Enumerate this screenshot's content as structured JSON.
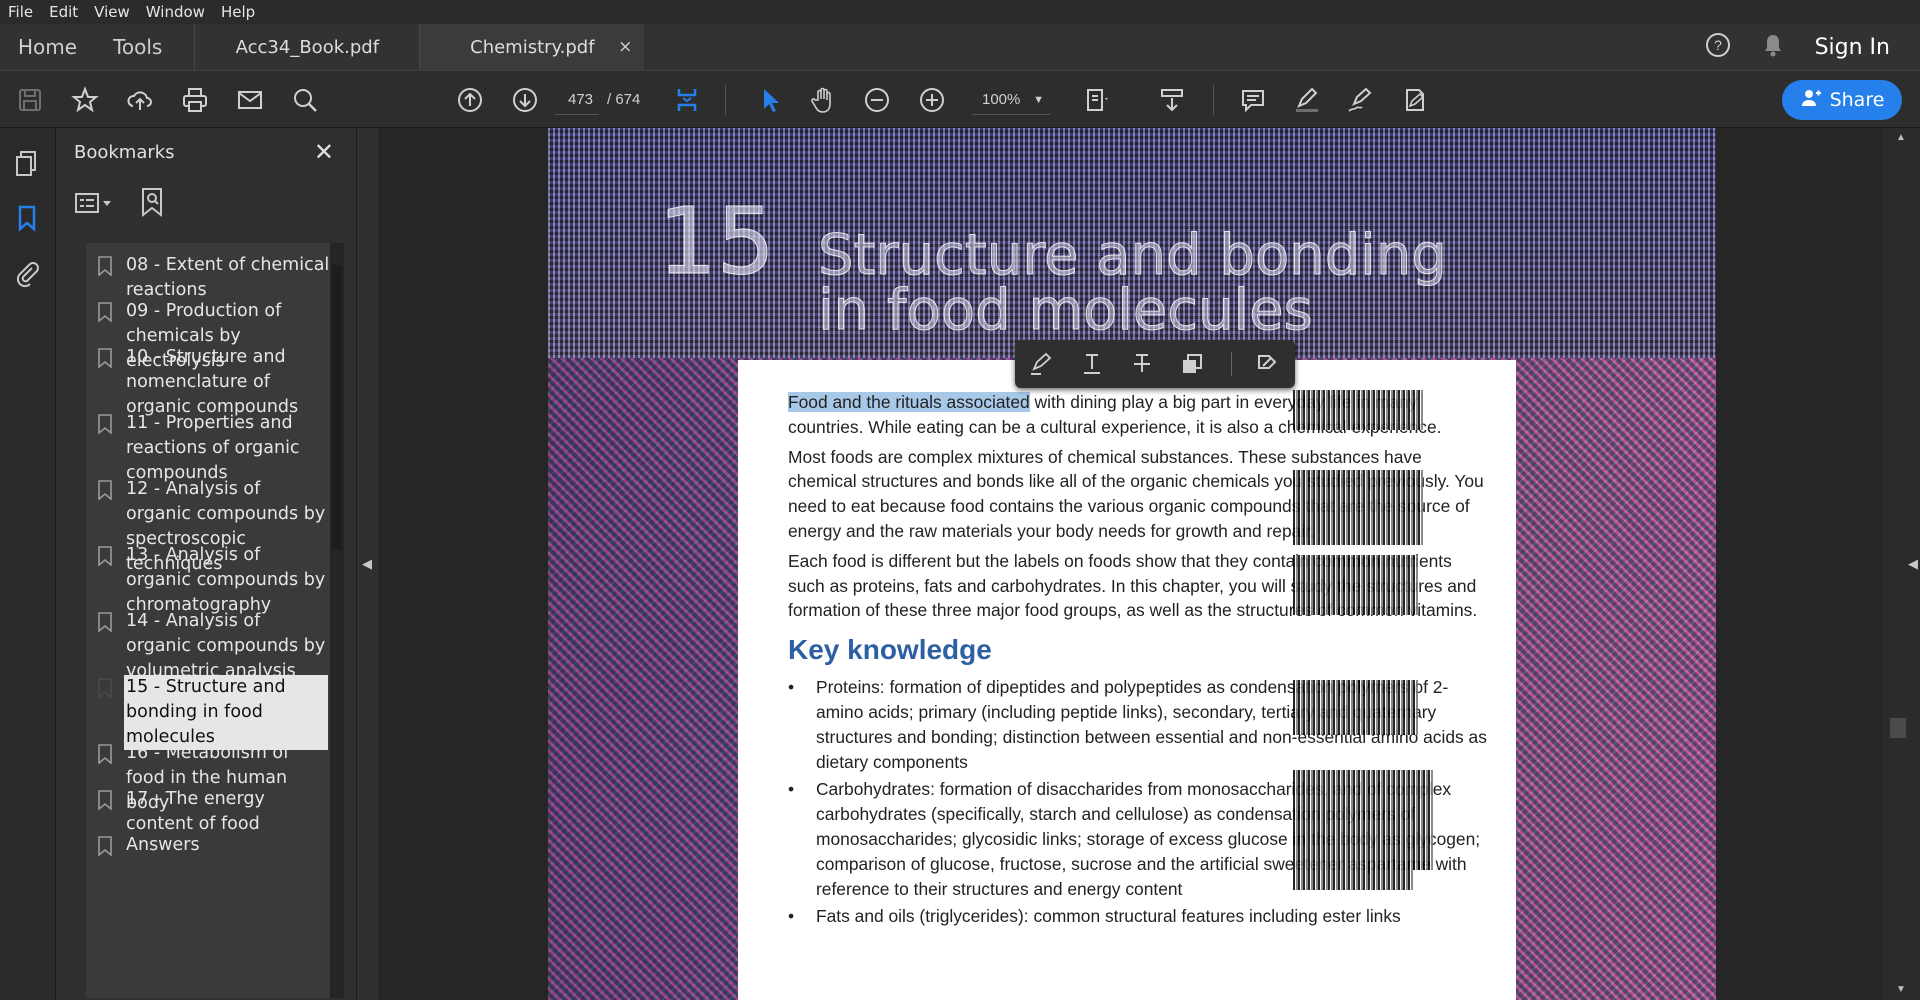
{
  "menu": [
    "File",
    "Edit",
    "View",
    "Window",
    "Help"
  ],
  "nav": {
    "home": "Home",
    "tools": "Tools"
  },
  "tabs": [
    {
      "label": "Acc34_Book.pdf"
    },
    {
      "label": "Chemistry.pdf",
      "close": "×"
    }
  ],
  "header": {
    "sign_in": "Sign In"
  },
  "toolbar": {
    "page_current": "473",
    "page_sep_total": "/  674",
    "zoom": "100%",
    "share": "Share"
  },
  "bookmarks": {
    "title": "Bookmarks",
    "close": "✕",
    "items": [
      {
        "label": "08 - Extent of chemical reactions"
      },
      {
        "label": "09 - Production of chemicals by electrolysis"
      },
      {
        "label": "10 - Structure and nomenclature of organic compounds"
      },
      {
        "label": "11 - Properties and reactions of organic compounds"
      },
      {
        "label": "12 - Analysis of organic compounds by spectroscopic techniques"
      },
      {
        "label": "13 - Analysis of organic compounds by chromatography"
      },
      {
        "label": "14 - Analysis of organic compounds by volumetric analysis"
      },
      {
        "label": "15 - Structure and bonding in food molecules",
        "selected": true
      },
      {
        "label": "16 - Metabolism of food in the human body"
      },
      {
        "label": "17 - The energy content of food"
      },
      {
        "label": "Answers"
      }
    ]
  },
  "document": {
    "banner": {
      "chapter": "15",
      "title_line1": "Structure and bonding",
      "title_line2": "in food molecules"
    },
    "para1_highlight": "Food and the rituals associated",
    "para1_rest": " with dining play a big part in everyday life in many countries. While eating can be a cultural experience, it is also a chemical experience.",
    "para2": "Most foods are complex mixtures of chemical substances. These substances have chemical structures and bonds like all of the organic chemicals you studied previously. You need to eat because food contains the various organic compounds that are the source of energy and the raw materials your body needs for growth and repair.",
    "para3": "Each food is different but the labels on foods show that they contain common nutrients such as proteins, fats and carbohydrates. In this chapter, you will study the structures and formation of these three major food groups, as well as the structures of common vitamins.",
    "heading": "Key knowledge",
    "bullets": [
      "Proteins: formation of dipeptides and polypeptides as condensation polymers of 2-amino acids; primary (including peptide links), secondary, tertiary and quaternary structures and bonding; distinction between essential and non-essential amino acids as dietary components",
      "Carbohydrates: formation of disaccharides from monosaccharides, and of complex carbohydrates (specifically, starch and cellulose) as condensation polymers of monosaccharides; glycosidic links; storage of excess glucose in the body as glycogen; comparison of glucose, fructose, sucrose and the artificial sweetener aspartame with reference to their structures and energy content",
      "Fats and oils (triglycerides): common structural features including ester links"
    ],
    "bullet_glyph": "•"
  }
}
